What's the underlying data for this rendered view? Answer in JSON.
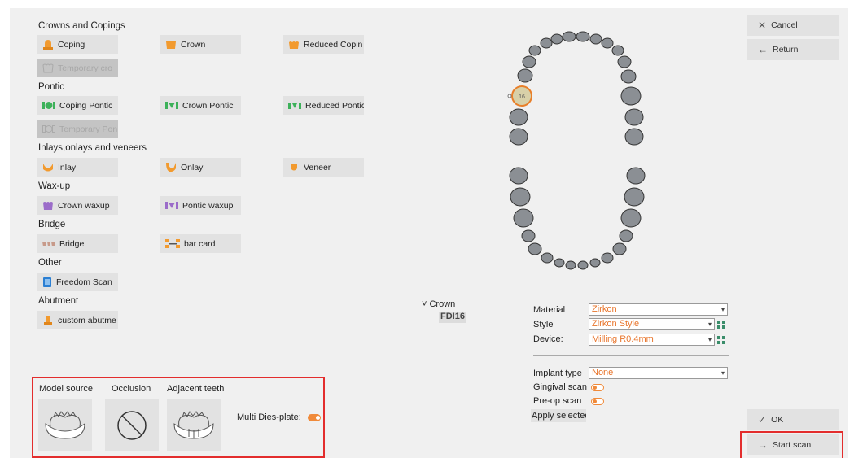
{
  "sections": {
    "crowns": "Crowns and Copings",
    "pontic": "Pontic",
    "inlays": "Inlays,onlays and veneers",
    "waxup": "Wax-up",
    "bridge": "Bridge",
    "other": "Other",
    "abutment": "Abutment"
  },
  "options": {
    "coping": "Coping",
    "crown": "Crown",
    "reduced_coping": "Reduced Copin",
    "temporary_crown": "Temporary cro",
    "coping_pontic": "Coping Pontic",
    "crown_pontic": "Crown Pontic",
    "reduced_pontic": "Reduced Pontic",
    "temporary_pontic": "Temporary Pon",
    "inlay": "Inlay",
    "onlay": "Onlay",
    "veneer": "Veneer",
    "crown_waxup": "Crown waxup",
    "pontic_waxup": "Pontic waxup",
    "bridge": "Bridge",
    "bar_card": "bar card",
    "freedom_scan": "Freedom Scan",
    "custom_abutment": "custom abutme"
  },
  "right_buttons": {
    "cancel": "Cancel",
    "return": "Return",
    "ok": "OK",
    "start_scan": "Start scan"
  },
  "selection": {
    "type": "Crown",
    "tooth": "FDI16",
    "selected_tooth_label": "16"
  },
  "props": {
    "material_label": "Material",
    "material_value": "Zirkon",
    "style_label": "Style",
    "style_value": "Zirkon Style",
    "device_label": "Device:",
    "device_value": "Milling R0.4mm",
    "implant_label": "Implant type",
    "implant_value": "None",
    "gingival_label": "Gingival scan",
    "preop_label": "Pre-op scan",
    "apply_label": "Apply selectec"
  },
  "bottom": {
    "model_source": "Model source",
    "occlusion": "Occlusion",
    "adjacent": "Adjacent teeth",
    "multi_dies": "Multi Dies-plate:"
  },
  "colors": {
    "accent": "#f08a3a",
    "highlight_red": "#e32d2d",
    "select_text": "#e8742a"
  }
}
